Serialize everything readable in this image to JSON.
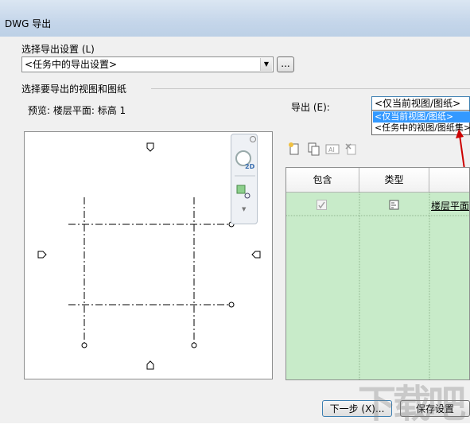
{
  "window": {
    "title": "DWG 导出"
  },
  "settings": {
    "label": "选择导出设置 (L)",
    "value": "<任务中的导出设置>",
    "browse_label": "..."
  },
  "views_group": {
    "label": "选择要导出的视图和图纸"
  },
  "preview": {
    "label": "预览:  楼层平面:  标高 1"
  },
  "export": {
    "label": "导出 (E):",
    "value": "<仅当前视图/图纸>",
    "options": [
      "<仅当前视图/图纸>",
      "<任务中的视图/图纸集>"
    ]
  },
  "table": {
    "columns": [
      "包含",
      "类型",
      ""
    ],
    "rows": [
      {
        "include": true,
        "type": "view-icon",
        "name": "楼层平面"
      }
    ]
  },
  "navbar": {
    "badge": "2D"
  },
  "buttons": {
    "next": "下一步 (X)...",
    "save": "保存设置"
  },
  "watermark": "下载吧",
  "colors": {
    "grid_bg": "#c8ebc9",
    "selection": "#3399ff",
    "arrow": "#cc0000"
  }
}
